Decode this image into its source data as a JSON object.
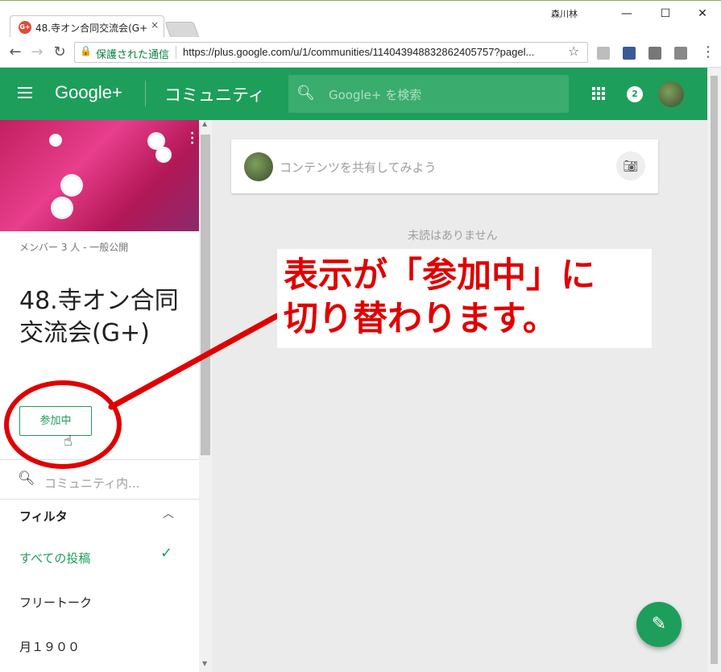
{
  "browser": {
    "tab_title": "48.寺オン合同交流会(G+)",
    "tab_close": "×",
    "favicon": "G+",
    "user_name": "森川林",
    "window_controls": [
      "—",
      "☐",
      "✕"
    ],
    "secure_label": "保護された通信",
    "url": "https://plus.google.com/u/1/communities/114043948832862405757?pagel..."
  },
  "header": {
    "logo": "Google+",
    "section": "コミュニティ",
    "search_placeholder": "Google+ を検索",
    "notification_count": "2"
  },
  "community": {
    "members": "メンバー 3 人 - 一般公開",
    "title": "48.寺オン合同交流会(G+)",
    "join_label": "参加中",
    "search_placeholder": "コミュニティ内...",
    "filter_title": "フィルタ",
    "filters": [
      "すべての投稿",
      "フリートーク",
      "月１９００"
    ]
  },
  "main": {
    "share_placeholder": "コンテンツを共有してみよう",
    "no_unread": "未読はありません"
  },
  "annotation": {
    "line1": "表示が「参加中」に",
    "line2": "切り替わります。",
    "color": "#e00000"
  },
  "colors": {
    "brand": "#1e9e5b",
    "annotation": "#e00000"
  }
}
